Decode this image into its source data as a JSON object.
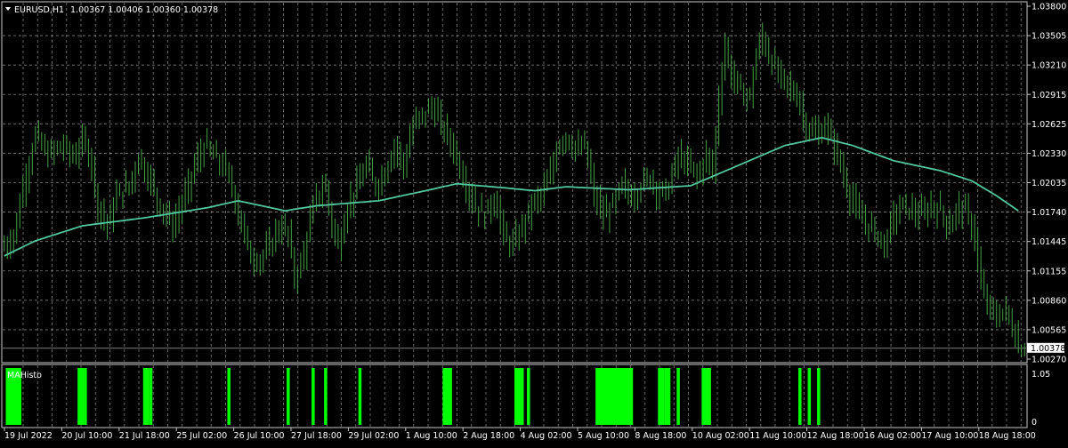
{
  "header": {
    "symbol_timeframe": "EURUSD,H1",
    "ohlc": "1.00367 1.00406 1.00360 1.00378"
  },
  "indicator": {
    "name": "MAHisto",
    "scale_top": "1.05",
    "scale_bottom": "0"
  },
  "colors": {
    "background": "#000000",
    "candle": "#45a245",
    "moving_average": "#50c8a0",
    "grid": "#b4b4b4",
    "histogram": "#00ff00",
    "text": "#ffffff"
  },
  "chart_data": {
    "type": "line",
    "title": "EURUSD,H1",
    "xlabel": "",
    "ylabel": "",
    "ylim": [
      1.0027,
      1.038
    ],
    "price_ticks": [
      "1.03800",
      "1.03505",
      "1.03210",
      "1.02915",
      "1.02625",
      "1.02330",
      "1.02035",
      "1.01740",
      "1.01445",
      "1.01155",
      "1.00860",
      "1.00565",
      "1.00270"
    ],
    "current_price": "1.00378",
    "x_ticks": [
      "19 Jul 2022",
      "20 Jul 10:00",
      "21 Jul 18:00",
      "25 Jul 02:00",
      "26 Jul 10:00",
      "27 Jul 18:00",
      "29 Jul 02:00",
      "1 Aug 10:00",
      "2 Aug 18:00",
      "4 Aug 02:00",
      "5 Aug 10:00",
      "8 Aug 18:00",
      "10 Aug 02:00",
      "11 Aug 10:00",
      "12 Aug 18:00",
      "16 Aug 02:00",
      "17 Aug 10:00",
      "18 Aug 18:00"
    ],
    "price_series": [
      {
        "name": "EURUSD",
        "points": [
          [
            0,
            1.014
          ],
          [
            3,
            1.015
          ],
          [
            6,
            1.02
          ],
          [
            10,
            1.025
          ],
          [
            14,
            1.023
          ],
          [
            18,
            1.024
          ],
          [
            22,
            1.023
          ],
          [
            26,
            1.0245
          ],
          [
            28,
            1.022
          ],
          [
            30,
            1.018
          ],
          [
            33,
            1.016
          ],
          [
            36,
            1.019
          ],
          [
            40,
            1.02
          ],
          [
            43,
            1.023
          ],
          [
            46,
            1.021
          ],
          [
            50,
            1.018
          ],
          [
            54,
            1.016
          ],
          [
            58,
            1.019
          ],
          [
            61,
            1.022
          ],
          [
            64,
            1.024
          ],
          [
            67,
            1.023
          ],
          [
            70,
            1.022
          ],
          [
            73,
            1.02
          ],
          [
            76,
            1.016
          ],
          [
            79,
            1.013
          ],
          [
            82,
            1.0125
          ],
          [
            85,
            1.014
          ],
          [
            88,
            1.016
          ],
          [
            91,
            1.015
          ],
          [
            93,
            1.011
          ],
          [
            95,
            1.012
          ],
          [
            97,
            1.015
          ],
          [
            100,
            1.019
          ],
          [
            103,
            1.02
          ],
          [
            105,
            1.016
          ],
          [
            107,
            1.014
          ],
          [
            110,
            1.018
          ],
          [
            113,
            1.02
          ],
          [
            116,
            1.022
          ],
          [
            119,
            1.02
          ],
          [
            122,
            1.0215
          ],
          [
            125,
            1.024
          ],
          [
            128,
            1.022
          ],
          [
            131,
            1.026
          ],
          [
            134,
            1.027
          ],
          [
            137,
            1.028
          ],
          [
            140,
            1.026
          ],
          [
            142,
            1.025
          ],
          [
            145,
            1.023
          ],
          [
            148,
            1.02
          ],
          [
            151,
            1.018
          ],
          [
            154,
            1.017
          ],
          [
            157,
            1.019
          ],
          [
            160,
            1.015
          ],
          [
            163,
            1.014
          ],
          [
            166,
            1.016
          ],
          [
            169,
            1.018
          ],
          [
            172,
            1.019
          ],
          [
            175,
            1.021
          ],
          [
            177,
            1.024
          ],
          [
            180,
            1.025
          ],
          [
            183,
            1.0235
          ],
          [
            186,
            1.024
          ],
          [
            189,
            1.019
          ],
          [
            192,
            1.017
          ],
          [
            195,
            1.018
          ],
          [
            198,
            1.02
          ],
          [
            201,
            1.019
          ],
          [
            204,
            1.02
          ],
          [
            207,
            1.021
          ],
          [
            210,
            1.019
          ],
          [
            213,
            1.02
          ],
          [
            216,
            1.023
          ],
          [
            219,
            1.022
          ],
          [
            222,
            1.021
          ],
          [
            225,
            1.023
          ],
          [
            227,
            1.0215
          ],
          [
            229,
            1.029
          ],
          [
            231,
            1.034
          ],
          [
            233,
            1.031
          ],
          [
            235,
            1.03
          ],
          [
            237,
            1.029
          ],
          [
            239,
            1.029
          ],
          [
            241,
            1.033
          ],
          [
            243,
            1.035
          ],
          [
            245,
            1.033
          ],
          [
            248,
            1.031
          ],
          [
            251,
            1.03
          ],
          [
            254,
            1.029
          ],
          [
            257,
            1.026
          ],
          [
            260,
            1.025
          ],
          [
            263,
            1.026
          ],
          [
            266,
            1.024
          ],
          [
            268,
            1.022
          ],
          [
            271,
            1.019
          ],
          [
            274,
            1.017
          ],
          [
            277,
            1.016
          ],
          [
            280,
            1.015
          ],
          [
            282,
            1.014
          ],
          [
            285,
            1.017
          ],
          [
            288,
            1.018
          ],
          [
            291,
            1.0175
          ],
          [
            294,
            1.017
          ],
          [
            297,
            1.018
          ],
          [
            300,
            1.0175
          ],
          [
            303,
            1.016
          ],
          [
            306,
            1.018
          ],
          [
            309,
            1.017
          ],
          [
            311,
            1.015
          ],
          [
            313,
            1.01
          ],
          [
            315,
            1.008
          ],
          [
            318,
            1.007
          ],
          [
            321,
            1.0075
          ],
          [
            323,
            1.006
          ],
          [
            325,
            1.004
          ],
          [
            327,
            1.0038
          ]
        ]
      },
      {
        "name": "MA",
        "points": [
          [
            0,
            1.013
          ],
          [
            10,
            1.0145
          ],
          [
            25,
            1.016
          ],
          [
            45,
            1.0168
          ],
          [
            65,
            1.0178
          ],
          [
            75,
            1.0185
          ],
          [
            90,
            1.0175
          ],
          [
            100,
            1.018
          ],
          [
            120,
            1.0185
          ],
          [
            135,
            1.0195
          ],
          [
            145,
            1.0202
          ],
          [
            160,
            1.0198
          ],
          [
            170,
            1.0195
          ],
          [
            180,
            1.0199
          ],
          [
            200,
            1.0196
          ],
          [
            220,
            1.02
          ],
          [
            235,
            1.022
          ],
          [
            250,
            1.024
          ],
          [
            262,
            1.0248
          ],
          [
            272,
            1.024
          ],
          [
            285,
            1.0225
          ],
          [
            300,
            1.0215
          ],
          [
            310,
            1.0205
          ],
          [
            318,
            1.019
          ],
          [
            325,
            1.0175
          ]
        ]
      }
    ],
    "histogram_bars": [
      [
        1,
        5
      ],
      [
        24,
        2
      ],
      [
        26,
        1
      ],
      [
        45,
        2
      ],
      [
        47,
        1
      ],
      [
        72,
        1
      ],
      [
        91,
        1
      ],
      [
        99,
        1
      ],
      [
        103,
        1
      ],
      [
        114,
        1
      ],
      [
        141,
        3
      ],
      [
        164,
        3
      ],
      [
        168,
        1
      ],
      [
        190,
        12
      ],
      [
        210,
        2
      ],
      [
        212,
        2
      ],
      [
        216,
        1
      ],
      [
        224,
        3
      ],
      [
        255,
        1
      ],
      [
        258,
        1
      ],
      [
        261,
        1
      ]
    ]
  }
}
